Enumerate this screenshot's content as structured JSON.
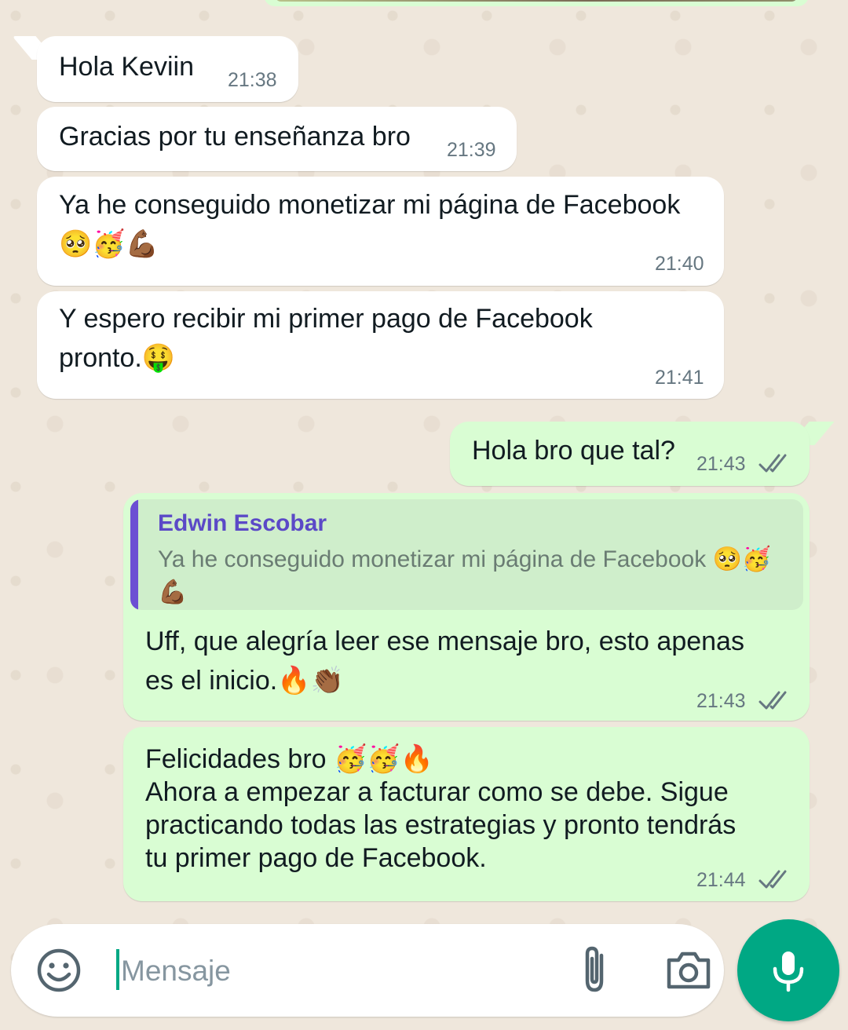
{
  "messages": [
    {
      "text": "Hola Keviin",
      "time": "21:38",
      "direction": "incoming"
    },
    {
      "text": "Gracias por tu enseñanza bro",
      "time": "21:39",
      "direction": "incoming"
    },
    {
      "text": "Ya he conseguido monetizar mi página de Facebook\n🥺🥳💪🏾",
      "time": "21:40",
      "direction": "incoming"
    },
    {
      "text": "Y espero recibir mi primer pago de Facebook\npronto.🤑",
      "time": "21:41",
      "direction": "incoming"
    },
    {
      "text": "Hola bro que tal?",
      "time": "21:43",
      "direction": "outgoing",
      "status": "delivered"
    },
    {
      "text": "Uff, que alegría leer ese mensaje bro, esto apenas\nes el inicio.🔥👏🏾",
      "time": "21:43",
      "direction": "outgoing",
      "status": "delivered",
      "quote": {
        "author": "Edwin Escobar",
        "text": "Ya he conseguido monetizar mi página de Facebook 🥺🥳\n💪🏾"
      }
    },
    {
      "text": "Felicidades bro 🥳🥳🔥\nAhora a empezar a facturar como se debe. Sigue\npracticando todas las estrategias y pronto tendrás\ntu primer pago de Facebook.",
      "time": "21:44",
      "direction": "outgoing",
      "status": "delivered"
    }
  ],
  "composer": {
    "placeholder": "Mensaje",
    "emoji_icon": "emoji-icon",
    "attach_icon": "paperclip-icon",
    "camera_icon": "camera-icon",
    "mic_icon": "microphone-icon"
  },
  "colors": {
    "wallpaper": "#efe7dc",
    "incoming_bubble": "#ffffff",
    "outgoing_bubble": "#d9fdd3",
    "accent": "#00a884",
    "quote_bar": "#6c4fd3",
    "quote_author": "#5b49c7",
    "read_ticks": "#667781"
  }
}
